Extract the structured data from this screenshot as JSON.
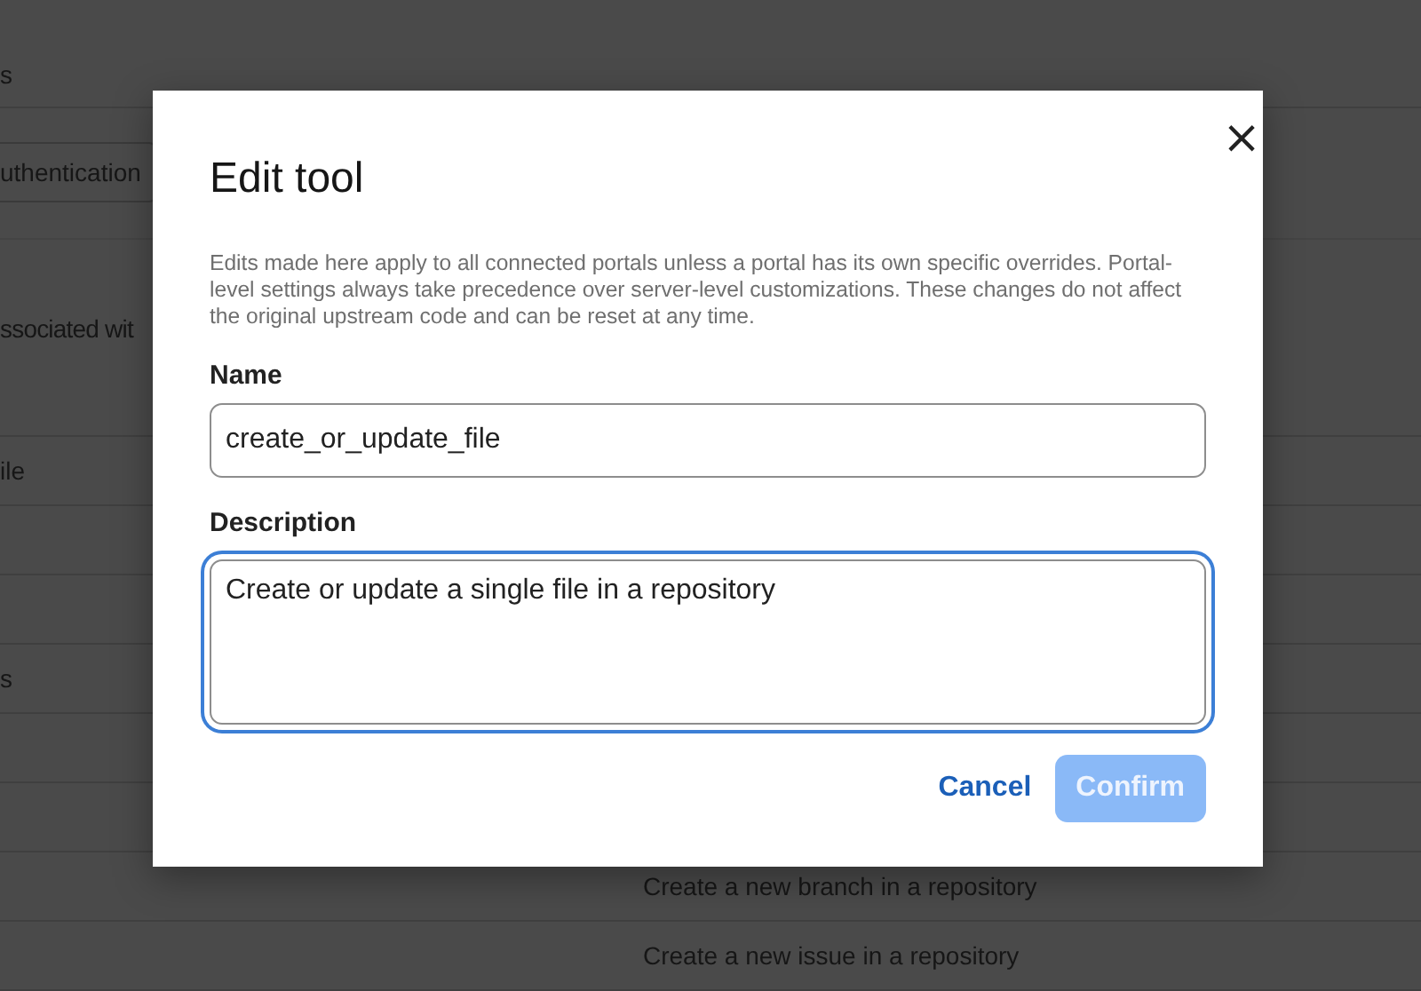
{
  "background": {
    "tab_fragment": "s",
    "auth_button": "uthentication",
    "section_heading": "ssociated wit",
    "rows": [
      {
        "column_1": "ile"
      },
      {},
      {},
      {
        "column_1": "s"
      },
      {},
      {},
      {
        "column_2": "Create a new branch in a repository"
      },
      {
        "column_2": "Create a new issue in a repository"
      }
    ]
  },
  "dialog": {
    "title": "Edit tool",
    "close": "×",
    "notice": "Edits made here apply to all connected portals unless a portal has its own specific overrides. Portal-level settings always take precedence over server-level customizations. These changes do not affect the original upstream code and can be reset at any time.",
    "fields": [
      {
        "label": "Name",
        "kind": "input",
        "value": "create_or_update_file",
        "focused": false
      },
      {
        "label": "Description",
        "kind": "textarea",
        "value": "Create or update a single file in a repository",
        "focused": true
      }
    ],
    "buttons": [
      {
        "label": "Cancel",
        "kind": "link",
        "disabled": false
      },
      {
        "label": "Confirm",
        "kind": "primary",
        "disabled": true
      }
    ]
  }
}
